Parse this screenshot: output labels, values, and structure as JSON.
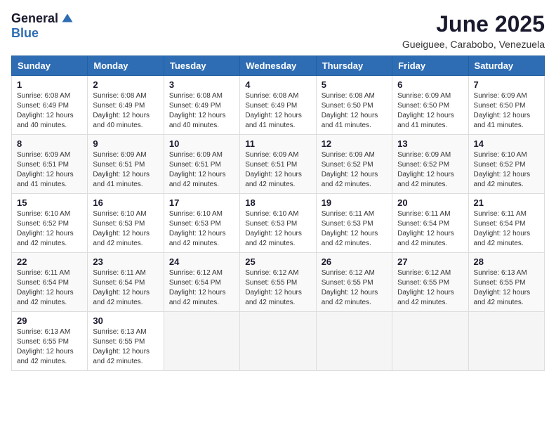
{
  "logo": {
    "general": "General",
    "blue": "Blue"
  },
  "title": "June 2025",
  "location": "Gueiguee, Carabobo, Venezuela",
  "days_of_week": [
    "Sunday",
    "Monday",
    "Tuesday",
    "Wednesday",
    "Thursday",
    "Friday",
    "Saturday"
  ],
  "weeks": [
    [
      {
        "day": "1",
        "sunrise": "6:08 AM",
        "sunset": "6:49 PM",
        "daylight": "12 hours and 40 minutes."
      },
      {
        "day": "2",
        "sunrise": "6:08 AM",
        "sunset": "6:49 PM",
        "daylight": "12 hours and 40 minutes."
      },
      {
        "day": "3",
        "sunrise": "6:08 AM",
        "sunset": "6:49 PM",
        "daylight": "12 hours and 40 minutes."
      },
      {
        "day": "4",
        "sunrise": "6:08 AM",
        "sunset": "6:49 PM",
        "daylight": "12 hours and 41 minutes."
      },
      {
        "day": "5",
        "sunrise": "6:08 AM",
        "sunset": "6:50 PM",
        "daylight": "12 hours and 41 minutes."
      },
      {
        "day": "6",
        "sunrise": "6:09 AM",
        "sunset": "6:50 PM",
        "daylight": "12 hours and 41 minutes."
      },
      {
        "day": "7",
        "sunrise": "6:09 AM",
        "sunset": "6:50 PM",
        "daylight": "12 hours and 41 minutes."
      }
    ],
    [
      {
        "day": "8",
        "sunrise": "6:09 AM",
        "sunset": "6:51 PM",
        "daylight": "12 hours and 41 minutes."
      },
      {
        "day": "9",
        "sunrise": "6:09 AM",
        "sunset": "6:51 PM",
        "daylight": "12 hours and 41 minutes."
      },
      {
        "day": "10",
        "sunrise": "6:09 AM",
        "sunset": "6:51 PM",
        "daylight": "12 hours and 42 minutes."
      },
      {
        "day": "11",
        "sunrise": "6:09 AM",
        "sunset": "6:51 PM",
        "daylight": "12 hours and 42 minutes."
      },
      {
        "day": "12",
        "sunrise": "6:09 AM",
        "sunset": "6:52 PM",
        "daylight": "12 hours and 42 minutes."
      },
      {
        "day": "13",
        "sunrise": "6:09 AM",
        "sunset": "6:52 PM",
        "daylight": "12 hours and 42 minutes."
      },
      {
        "day": "14",
        "sunrise": "6:10 AM",
        "sunset": "6:52 PM",
        "daylight": "12 hours and 42 minutes."
      }
    ],
    [
      {
        "day": "15",
        "sunrise": "6:10 AM",
        "sunset": "6:52 PM",
        "daylight": "12 hours and 42 minutes."
      },
      {
        "day": "16",
        "sunrise": "6:10 AM",
        "sunset": "6:53 PM",
        "daylight": "12 hours and 42 minutes."
      },
      {
        "day": "17",
        "sunrise": "6:10 AM",
        "sunset": "6:53 PM",
        "daylight": "12 hours and 42 minutes."
      },
      {
        "day": "18",
        "sunrise": "6:10 AM",
        "sunset": "6:53 PM",
        "daylight": "12 hours and 42 minutes."
      },
      {
        "day": "19",
        "sunrise": "6:11 AM",
        "sunset": "6:53 PM",
        "daylight": "12 hours and 42 minutes."
      },
      {
        "day": "20",
        "sunrise": "6:11 AM",
        "sunset": "6:54 PM",
        "daylight": "12 hours and 42 minutes."
      },
      {
        "day": "21",
        "sunrise": "6:11 AM",
        "sunset": "6:54 PM",
        "daylight": "12 hours and 42 minutes."
      }
    ],
    [
      {
        "day": "22",
        "sunrise": "6:11 AM",
        "sunset": "6:54 PM",
        "daylight": "12 hours and 42 minutes."
      },
      {
        "day": "23",
        "sunrise": "6:11 AM",
        "sunset": "6:54 PM",
        "daylight": "12 hours and 42 minutes."
      },
      {
        "day": "24",
        "sunrise": "6:12 AM",
        "sunset": "6:54 PM",
        "daylight": "12 hours and 42 minutes."
      },
      {
        "day": "25",
        "sunrise": "6:12 AM",
        "sunset": "6:55 PM",
        "daylight": "12 hours and 42 minutes."
      },
      {
        "day": "26",
        "sunrise": "6:12 AM",
        "sunset": "6:55 PM",
        "daylight": "12 hours and 42 minutes."
      },
      {
        "day": "27",
        "sunrise": "6:12 AM",
        "sunset": "6:55 PM",
        "daylight": "12 hours and 42 minutes."
      },
      {
        "day": "28",
        "sunrise": "6:13 AM",
        "sunset": "6:55 PM",
        "daylight": "12 hours and 42 minutes."
      }
    ],
    [
      {
        "day": "29",
        "sunrise": "6:13 AM",
        "sunset": "6:55 PM",
        "daylight": "12 hours and 42 minutes."
      },
      {
        "day": "30",
        "sunrise": "6:13 AM",
        "sunset": "6:55 PM",
        "daylight": "12 hours and 42 minutes."
      },
      null,
      null,
      null,
      null,
      null
    ]
  ]
}
